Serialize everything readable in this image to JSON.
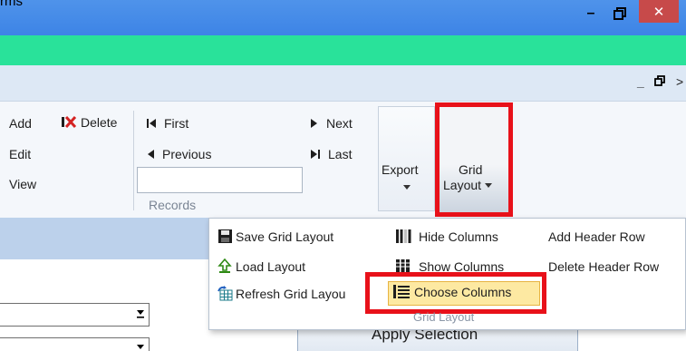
{
  "window": {
    "title_fragment": "rms",
    "minimize": "–",
    "maximize": "▭",
    "close": "✕",
    "mdi_minimize": "_",
    "mdi_restore": "ᗷ",
    "mdi_close": ">"
  },
  "ribbon": {
    "actions": {
      "add": "Add",
      "delete": "Delete",
      "edit": "Edit",
      "view": "View"
    },
    "navigation": {
      "first": "First",
      "next": "Next",
      "previous": "Previous",
      "last": "Last"
    },
    "records_group": "Records",
    "export": "Export",
    "grid_layout_line1": "Grid",
    "grid_layout_line2": "Layout"
  },
  "menu": {
    "save_grid_layout": "Save Grid Layout",
    "load_layout": "Load Layout",
    "refresh_grid_layout": "Refresh Grid Layou",
    "hide_columns": "Hide Columns",
    "show_columns": "Show Columns",
    "choose_columns": "Choose Columns",
    "add_header_row": "Add Header Row",
    "delete_header_row": "Delete Header Row",
    "group_label": "Grid Layout"
  },
  "content": {
    "apply_selection": "Apply Selection"
  },
  "colors": {
    "titlebar": "#4a8fe9",
    "greenbar": "#29e29a",
    "highlight_outline": "#e8111a",
    "menu_highlight": "#fde9a2"
  }
}
